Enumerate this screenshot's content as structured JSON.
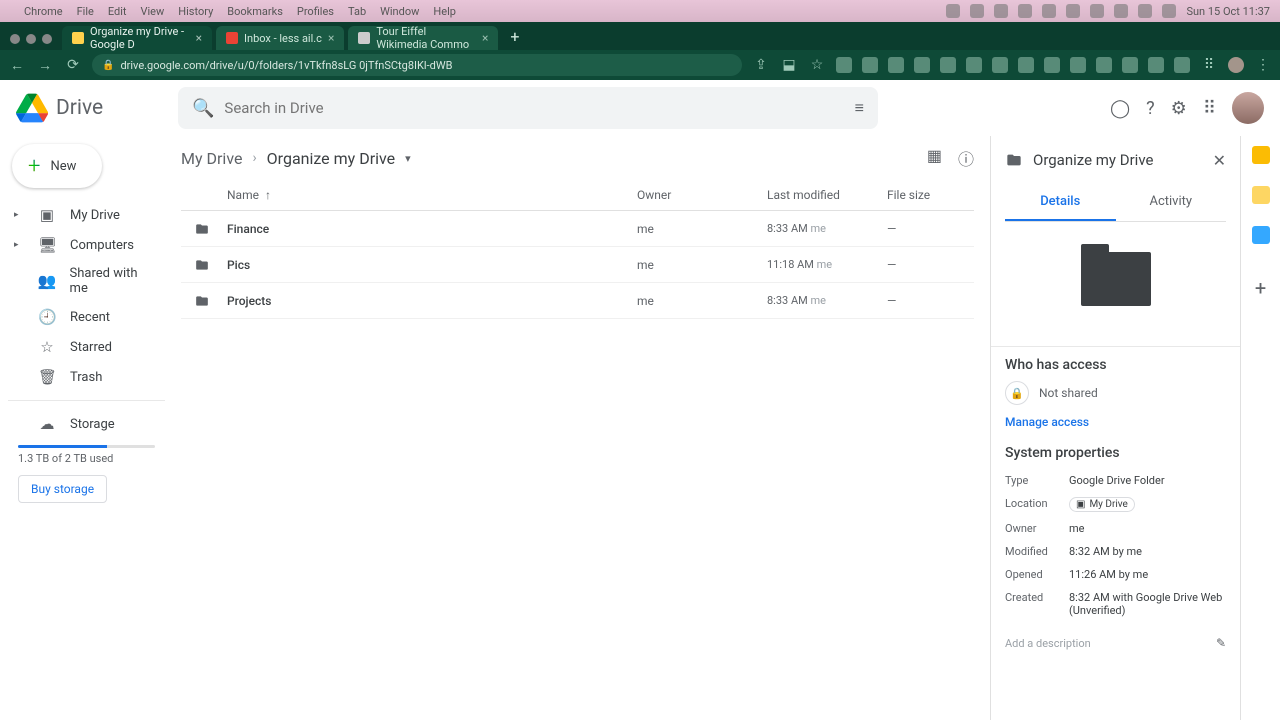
{
  "macos": {
    "app": "Chrome",
    "menus": [
      "File",
      "Edit",
      "View",
      "History",
      "Bookmarks",
      "Profiles",
      "Tab",
      "Window",
      "Help"
    ],
    "clock": "Sun 15 Oct  11:37"
  },
  "browser": {
    "tabs": [
      {
        "title": "Organize my Drive - Google D"
      },
      {
        "title": "Inbox - less              ail.c"
      },
      {
        "title": "Tour Eiffel Wikimedia Commo"
      }
    ],
    "url": "drive.google.com/drive/u/0/folders/1vTkfn8sLG          0jTfnSCtg8IKl-dWB"
  },
  "drive": {
    "app_name": "Drive",
    "search_placeholder": "Search in Drive",
    "new_label": "New",
    "nav": [
      {
        "label": "My Drive",
        "icon": "▸"
      },
      {
        "label": "Computers",
        "icon": "▸"
      },
      {
        "label": "Shared with me",
        "icon": ""
      },
      {
        "label": "Recent",
        "icon": ""
      },
      {
        "label": "Starred",
        "icon": ""
      },
      {
        "label": "Trash",
        "icon": ""
      }
    ],
    "storage_label": "Storage",
    "storage_used": "1.3 TB of 2 TB used",
    "buy": "Buy storage",
    "breadcrumbs": [
      "My Drive",
      "Organize my Drive"
    ],
    "columns": {
      "name": "Name",
      "owner": "Owner",
      "modified": "Last modified",
      "size": "File size"
    },
    "rows": [
      {
        "name": "Finance",
        "owner": "me",
        "modified": "8:33 AM",
        "by": "me",
        "size": "—"
      },
      {
        "name": "Pics",
        "owner": "me",
        "modified": "11:18 AM",
        "by": "me",
        "size": "—"
      },
      {
        "name": "Projects",
        "owner": "me",
        "modified": "8:33 AM",
        "by": "me",
        "size": "—"
      }
    ]
  },
  "details": {
    "title": "Organize my Drive",
    "tabs": {
      "details": "Details",
      "activity": "Activity"
    },
    "access_h": "Who has access",
    "not_shared": "Not shared",
    "manage": "Manage access",
    "sys_h": "System properties",
    "props": {
      "type_k": "Type",
      "type_v": "Google Drive Folder",
      "loc_k": "Location",
      "loc_v": "My Drive",
      "owner_k": "Owner",
      "owner_v": "me",
      "mod_k": "Modified",
      "mod_v": "8:32 AM by me",
      "open_k": "Opened",
      "open_v": "11:26 AM by me",
      "created_k": "Created",
      "created_v": "8:32 AM with Google Drive Web (Unverified)"
    },
    "desc_placeholder": "Add a description"
  }
}
